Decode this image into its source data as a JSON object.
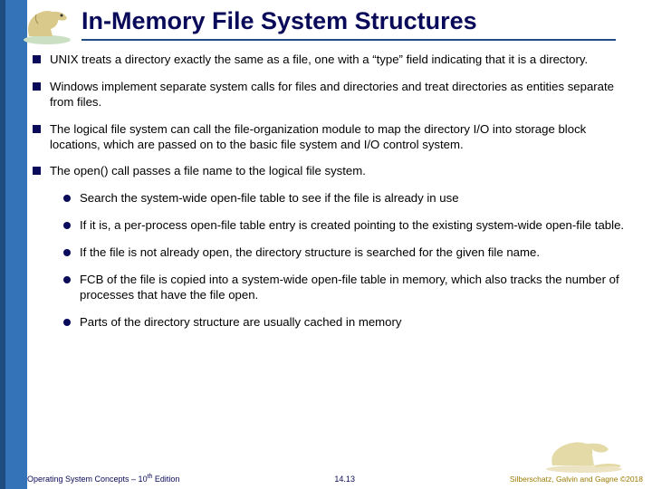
{
  "title": "In-Memory File System Structures",
  "bullets": [
    "UNIX treats a directory exactly the same as a file, one with a “type” field indicating that it is a directory.",
    "Windows implement separate system calls for files and directories and treat directories as entities separate from files.",
    "The logical file system can call the file-organization module to map the directory I/O into storage block locations, which are passed on to the basic file system and I/O control system.",
    "The open() call passes a file name to the logical file system."
  ],
  "subbullets": [
    "Search the system-wide open-file table to see if the file is already in use",
    "If it is, a per-process open-file table entry is created pointing to the existing system-wide open-file table.",
    "If the file is not already open, the directory structure is searched for the given file name.",
    "FCB of the file is copied into a system-wide open-file table in memory, which also tracks the number of processes that have the file open.",
    "Parts of the directory structure are usually cached in memory"
  ],
  "footer": {
    "left_a": "Operating System Concepts – 10",
    "left_sup": "th",
    "left_b": " Edition",
    "center": "14.13",
    "right": "Silberschatz, Galvin and Gagne ©2018"
  }
}
